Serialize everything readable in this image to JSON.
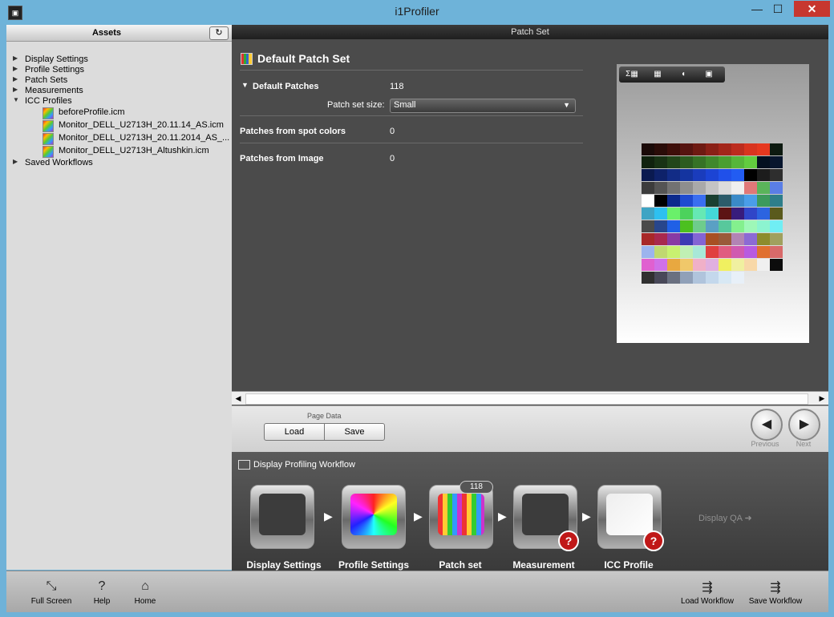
{
  "window": {
    "title": "i1Profiler",
    "min_glyph": "—",
    "max_glyph": "☐",
    "close_glyph": "✕"
  },
  "assets": {
    "title": "Assets",
    "refresh_glyph": "↻",
    "tree": [
      {
        "label": "Display Settings",
        "arrow": "▶"
      },
      {
        "label": "Profile Settings",
        "arrow": "▶"
      },
      {
        "label": "Patch Sets",
        "arrow": "▶"
      },
      {
        "label": "Measurements",
        "arrow": "▶"
      },
      {
        "label": "ICC Profiles",
        "arrow": "▼"
      },
      {
        "label": "Saved Workflows",
        "arrow": "▶"
      }
    ],
    "icc_files": [
      "beforeProfile.icm",
      "Monitor_DELL_U2713H_20.11.14_AS.icm",
      "Monitor_DELL_U2713H_20.11.2014_AS_...",
      "Monitor_DELL_U2713H_Altushkin.icm"
    ]
  },
  "patch_set": {
    "header": "Patch Set",
    "title": "Default Patch Set",
    "default_patches_label": "Default Patches",
    "default_patches_value": "118",
    "default_patches_arrow": "▼",
    "size_label": "Patch set size:",
    "size_value": "Small",
    "size_chevron": "▼",
    "spot_label": "Patches from spot colors",
    "spot_value": "0",
    "image_label": "Patches from Image",
    "image_value": "0"
  },
  "preview_toolbar": [
    "Σ▦",
    "▦",
    "◖",
    "▣"
  ],
  "patch_colors": [
    [
      "#1a0a08",
      "#2a0c08",
      "#3e0f0a",
      "#561410",
      "#6e1a12",
      "#8a2016",
      "#a3261a",
      "#bc2c1e",
      "#d8341f",
      "#e6381f",
      "#0d1a10"
    ],
    [
      "#10220e",
      "#183214",
      "#22461a",
      "#2c5c20",
      "#367226",
      "#40882c",
      "#4a9e30",
      "#56b63a",
      "#62cc3f",
      "#041020",
      "#08162e"
    ],
    [
      "#0a1a50",
      "#0e226a",
      "#122c86",
      "#1434a0",
      "#1a3cbc",
      "#1c44d4",
      "#2050ea",
      "#225cf2",
      "#000000",
      "#1c1c1c",
      "#2e2e2e"
    ],
    [
      "#3c3c3c",
      "#545454",
      "#727272",
      "#8e8e8e",
      "#a9a9a9",
      "#c4c4c4",
      "#dcdcdc",
      "#efefef",
      "#e07878",
      "#5ab45a",
      "#5a7ee6"
    ],
    [
      "#ffffff",
      "#000000",
      "#0c2a8c",
      "#1e4ad0",
      "#3a6ef0",
      "#1a4030",
      "#2c5c6a",
      "#3a8ac8",
      "#4a9ee8",
      "#3c9a5c",
      "#2e7e8a"
    ],
    [
      "#3ea4c4",
      "#2ec0f0",
      "#6af06a",
      "#4cd25c",
      "#66e8b4",
      "#44d8d8",
      "#5c1414",
      "#381c7c",
      "#3046c8",
      "#2c64e0",
      "#5a5a1c"
    ],
    [
      "#4a4a4a",
      "#28468c",
      "#2060e6",
      "#4cc020",
      "#6ecc8c",
      "#5aa0c4",
      "#58c89c",
      "#84f08e",
      "#9ef8b8",
      "#8cf4d0",
      "#70eef4"
    ],
    [
      "#a82828",
      "#a8284e",
      "#883aa4",
      "#3e3ab4",
      "#8464d4",
      "#a85024",
      "#9a5a3a",
      "#b284b4",
      "#8c6ad4",
      "#8c8c2c",
      "#a0a05e"
    ],
    [
      "#9cb4ee",
      "#c0d870",
      "#c8f070",
      "#c0f0b4",
      "#a8e8d8",
      "#e04040",
      "#e05c80",
      "#d05ab0",
      "#b85ae0",
      "#e07030",
      "#d86a6a"
    ],
    [
      "#e060d0",
      "#d070e8",
      "#e8a840",
      "#f0c86a",
      "#f0b0c8",
      "#e0b0e0",
      "#f0f060",
      "#f0f0a0",
      "#f8d8a8",
      "#f0f0f0",
      "#0c0c0c"
    ],
    [
      "#303030",
      "#484858",
      "#6a7080",
      "#90a0b8",
      "#b0c4dc",
      "#c4d8ec",
      "#d8e8f4",
      "#e8f0f8"
    ]
  ],
  "page_data": {
    "label": "Page Data",
    "load": "Load",
    "save": "Save",
    "previous": "Previous",
    "next": "Next",
    "prev_glyph": "◀",
    "next_glyph": "▶"
  },
  "workflow": {
    "title": "Display Profiling Workflow",
    "steps": [
      "Display Settings",
      "Profile Settings",
      "Patch set",
      "Measurement",
      "ICC Profile"
    ],
    "patch_count": "118",
    "arrow_glyph": "▶",
    "warn_glyph": "?",
    "qa_link": "Display QA ➜"
  },
  "toolbar": [
    {
      "label": "Full Screen",
      "glyph": "⤡"
    },
    {
      "label": "Help",
      "glyph": "?"
    },
    {
      "label": "Home",
      "glyph": "⌂"
    },
    {
      "label": "Load Workflow",
      "glyph": "⇶"
    },
    {
      "label": "Save Workflow",
      "glyph": "⇶"
    }
  ]
}
